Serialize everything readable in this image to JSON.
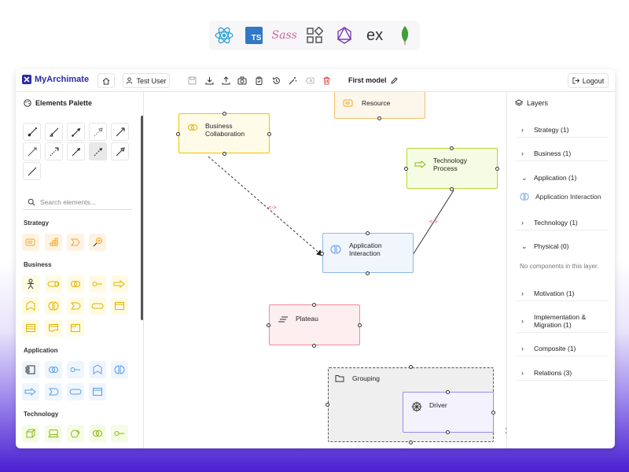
{
  "brand": {
    "name": "MyArchimate"
  },
  "header": {
    "user_label": "Test User",
    "model_name": "First model",
    "logout_label": "Logout"
  },
  "logos": [
    "react-logo",
    "typescript-logo",
    "sass-logo",
    "shadcn-logo",
    "graphql-logo",
    "express-logo",
    "mongodb-logo"
  ],
  "logo_text": {
    "ts": "TS",
    "sass": "Sass",
    "ex": "ex"
  },
  "palette": {
    "title": "Elements Palette",
    "search_placeholder": "Search elements...",
    "sections": {
      "strategy": "Strategy",
      "business": "Business",
      "application": "Application",
      "technology": "Technology"
    }
  },
  "canvas": {
    "nodes": {
      "resource": "Resource",
      "business_collaboration": "Business Collaboration",
      "technology_process": "Technology Process",
      "application_interaction": "Application Interaction",
      "plateau": "Plateau",
      "grouping": "Grouping",
      "driver": "Driver"
    },
    "zoom": {
      "in": "+",
      "out": "−"
    }
  },
  "layers": {
    "title": "Layers",
    "items": [
      {
        "label": "Strategy (1)"
      },
      {
        "label": "Business (1)"
      },
      {
        "label": "Application (1)"
      },
      {
        "label": "Technology (1)"
      },
      {
        "label": "Physical (0)"
      },
      {
        "label": "Motivation (1)"
      },
      {
        "label": "Implementation & Migration (1)"
      },
      {
        "label": "Composite (1)"
      },
      {
        "label": "Relations (3)"
      }
    ],
    "application_child": "Application Interaction",
    "physical_empty": "No components in this layer."
  },
  "colors": {
    "brand": "#2d2aa8",
    "strategy": "#f5a623",
    "business": "#f2c200",
    "application": "#5a9be6",
    "technology": "#a3d321",
    "motivation": "#c5c0f0",
    "implementation": "#f08a9a",
    "relation_marker": "#e0454b"
  }
}
